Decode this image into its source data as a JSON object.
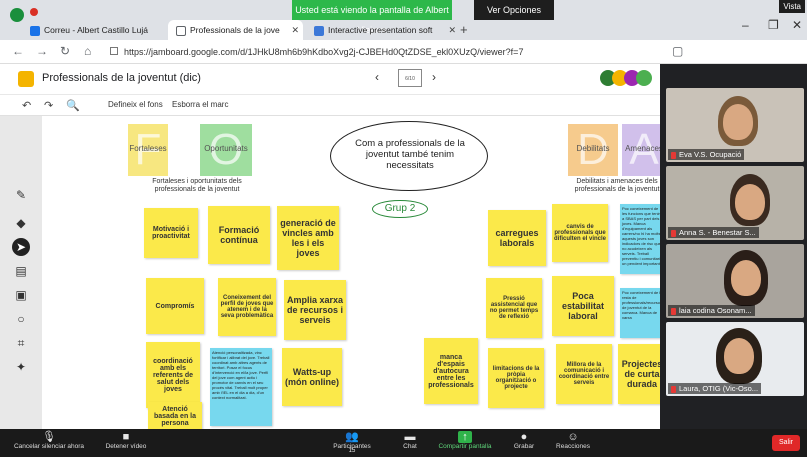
{
  "zoom_top": {
    "banner": "Usted está viendo la pantalla de Albert Viejove",
    "options": "Ver Opciones",
    "vista": "Vista"
  },
  "browser": {
    "tabs": [
      {
        "label": "Correu - Albert Castillo Lujá"
      },
      {
        "label": "Professionals de la jove"
      },
      {
        "label": "Interactive presentation soft"
      }
    ],
    "url": "https://jamboard.google.com/d/1JHkU8mh6b9hKdboXvg2j-CJBEHd0QtZDSE_ekl0XUzQ/viewer?f=7"
  },
  "jamboard": {
    "title": "Professionals de la joventut (dic)",
    "frame_label": "6/10",
    "toolbar": {
      "set_background": "Defineix el fons",
      "clear_frame": "Esborra el marc"
    }
  },
  "board": {
    "letters": [
      {
        "letter": "F",
        "label": "Fortaleses",
        "color": "#f6e36b"
      },
      {
        "letter": "O",
        "label": "Oportunitats",
        "color": "#8fd98f"
      },
      {
        "letter": "D",
        "label": "Debilitats",
        "color": "#f5c27a"
      },
      {
        "letter": "A",
        "label": "Amenaces",
        "color": "#c9b6e8"
      }
    ],
    "left_subtitle": "Fortaleses i oportunitats dels professionals de la joventut",
    "right_subtitle": "Debilitats i amenaces dels professionals de la joventut",
    "ellipse_text": "Com a professionals de la joventut també tenim necessitats",
    "group_label": "Grup 2",
    "notes": [
      {
        "text": "Motivació i proactivitat"
      },
      {
        "text": "Formació contínua"
      },
      {
        "text": "generació de vincles amb les i els joves"
      },
      {
        "text": "Compromís"
      },
      {
        "text": "Coneixement del perfil de joves que atenem i de la seva problemàtica"
      },
      {
        "text": "Amplia xarxa de recursos i serveis"
      },
      {
        "text": "coordinació amb els referents de salut dels joves"
      },
      {
        "text": "Atenció personalitzada, vinc fortificar i alibrat del jove. Treball coordinat amb altres agents de territori. Posar el focus d'intervenció en el/la jove. Perfil del jove com agent actiu i promotor de canvis en el seu procés vital. Treball molt proper amb i'IEL en el dia a dia, d'un context normalitzat."
      },
      {
        "text": "Watts-up (món online)"
      },
      {
        "text": "Atenció basada en la persona"
      },
      {
        "text": "carregues laborals"
      },
      {
        "text": "canvis de professionals que dificulten el vincle"
      },
      {
        "text": "Poc coneixement de les funcions que tenim a SBAS per part dels joves. Manca d'equipament als carrers/no hi ha molts aquests joves son indicadors de risc que no acudeixen als serveis. Treball preventiu i comunitari un pendent important"
      },
      {
        "text": "Pressió assistencial que no permet temps de reflexió"
      },
      {
        "text": "Poca estabilitat laboral"
      },
      {
        "text": "Poc coneixement de la resta de professionals/recursos de joventut de la comarca. Manca de xarxa"
      },
      {
        "text": "manca d'espais d'autocura entre les professionals"
      },
      {
        "text": "limitacions de la pròpia organització o projecte"
      },
      {
        "text": "Millora de la comunicació i coordinació entre serveis"
      },
      {
        "text": "Projectes de curta durada"
      }
    ]
  },
  "participants": [
    {
      "name": "Eva V.S. Ocupació"
    },
    {
      "name": "Anna S. - Benestar S..."
    },
    {
      "name": "laia codina Osonam..."
    },
    {
      "name": "Laura, OTIG (Vic-Oso..."
    }
  ],
  "zoom_bar": {
    "mute": "Cancelar silenciar ahora",
    "video": "Detener vídeo",
    "participants": "Participantes",
    "participants_count": "15",
    "chat": "Chat",
    "share": "Compartir pantalla",
    "record": "Grabar",
    "reactions": "Reacciones",
    "leave": "Salir"
  }
}
